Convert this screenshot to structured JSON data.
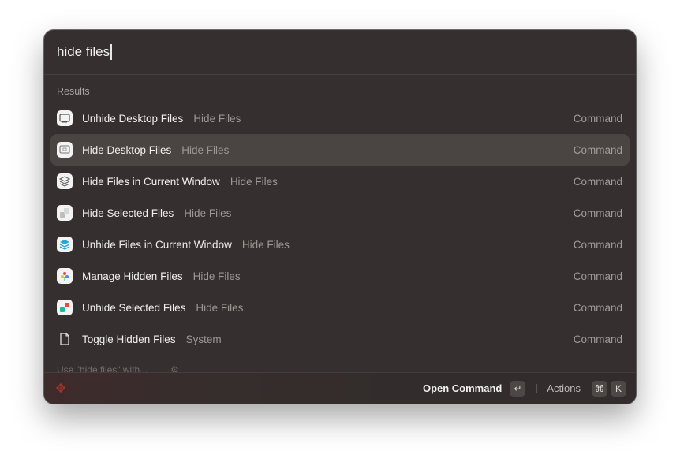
{
  "search": {
    "query": "hide files"
  },
  "section": {
    "title": "Results"
  },
  "results": [
    {
      "title": "Unhide Desktop Files",
      "subtitle": "Hide Files",
      "kind": "Command",
      "icon": "desktop-icon"
    },
    {
      "title": "Hide Desktop Files",
      "subtitle": "Hide Files",
      "kind": "Command",
      "icon": "desktop-hidden-icon",
      "selected": true
    },
    {
      "title": "Hide Files in Current Window",
      "subtitle": "Hide Files",
      "kind": "Command",
      "icon": "stack-icon"
    },
    {
      "title": "Hide Selected Files",
      "subtitle": "Hide Files",
      "kind": "Command",
      "icon": "squares-icon"
    },
    {
      "title": "Unhide Files in Current Window",
      "subtitle": "Hide Files",
      "kind": "Command",
      "icon": "layers-icon"
    },
    {
      "title": "Manage Hidden Files",
      "subtitle": "Hide Files",
      "kind": "Command",
      "icon": "pinwheel-icon"
    },
    {
      "title": "Unhide Selected Files",
      "subtitle": "Hide Files",
      "kind": "Command",
      "icon": "colored-squares-icon"
    },
    {
      "title": "Toggle Hidden Files",
      "subtitle": "System",
      "kind": "Command",
      "icon": "document-icon"
    }
  ],
  "fallback": {
    "text": "Use \"hide files\" with..."
  },
  "footer": {
    "primary_label": "Open Command",
    "primary_key": "↵",
    "actions_label": "Actions",
    "actions_keys": [
      "⌘",
      "K"
    ]
  },
  "colors": {
    "window_bg": "#35302f",
    "selected_row": "#4a4443",
    "logo": "#c0392b"
  }
}
